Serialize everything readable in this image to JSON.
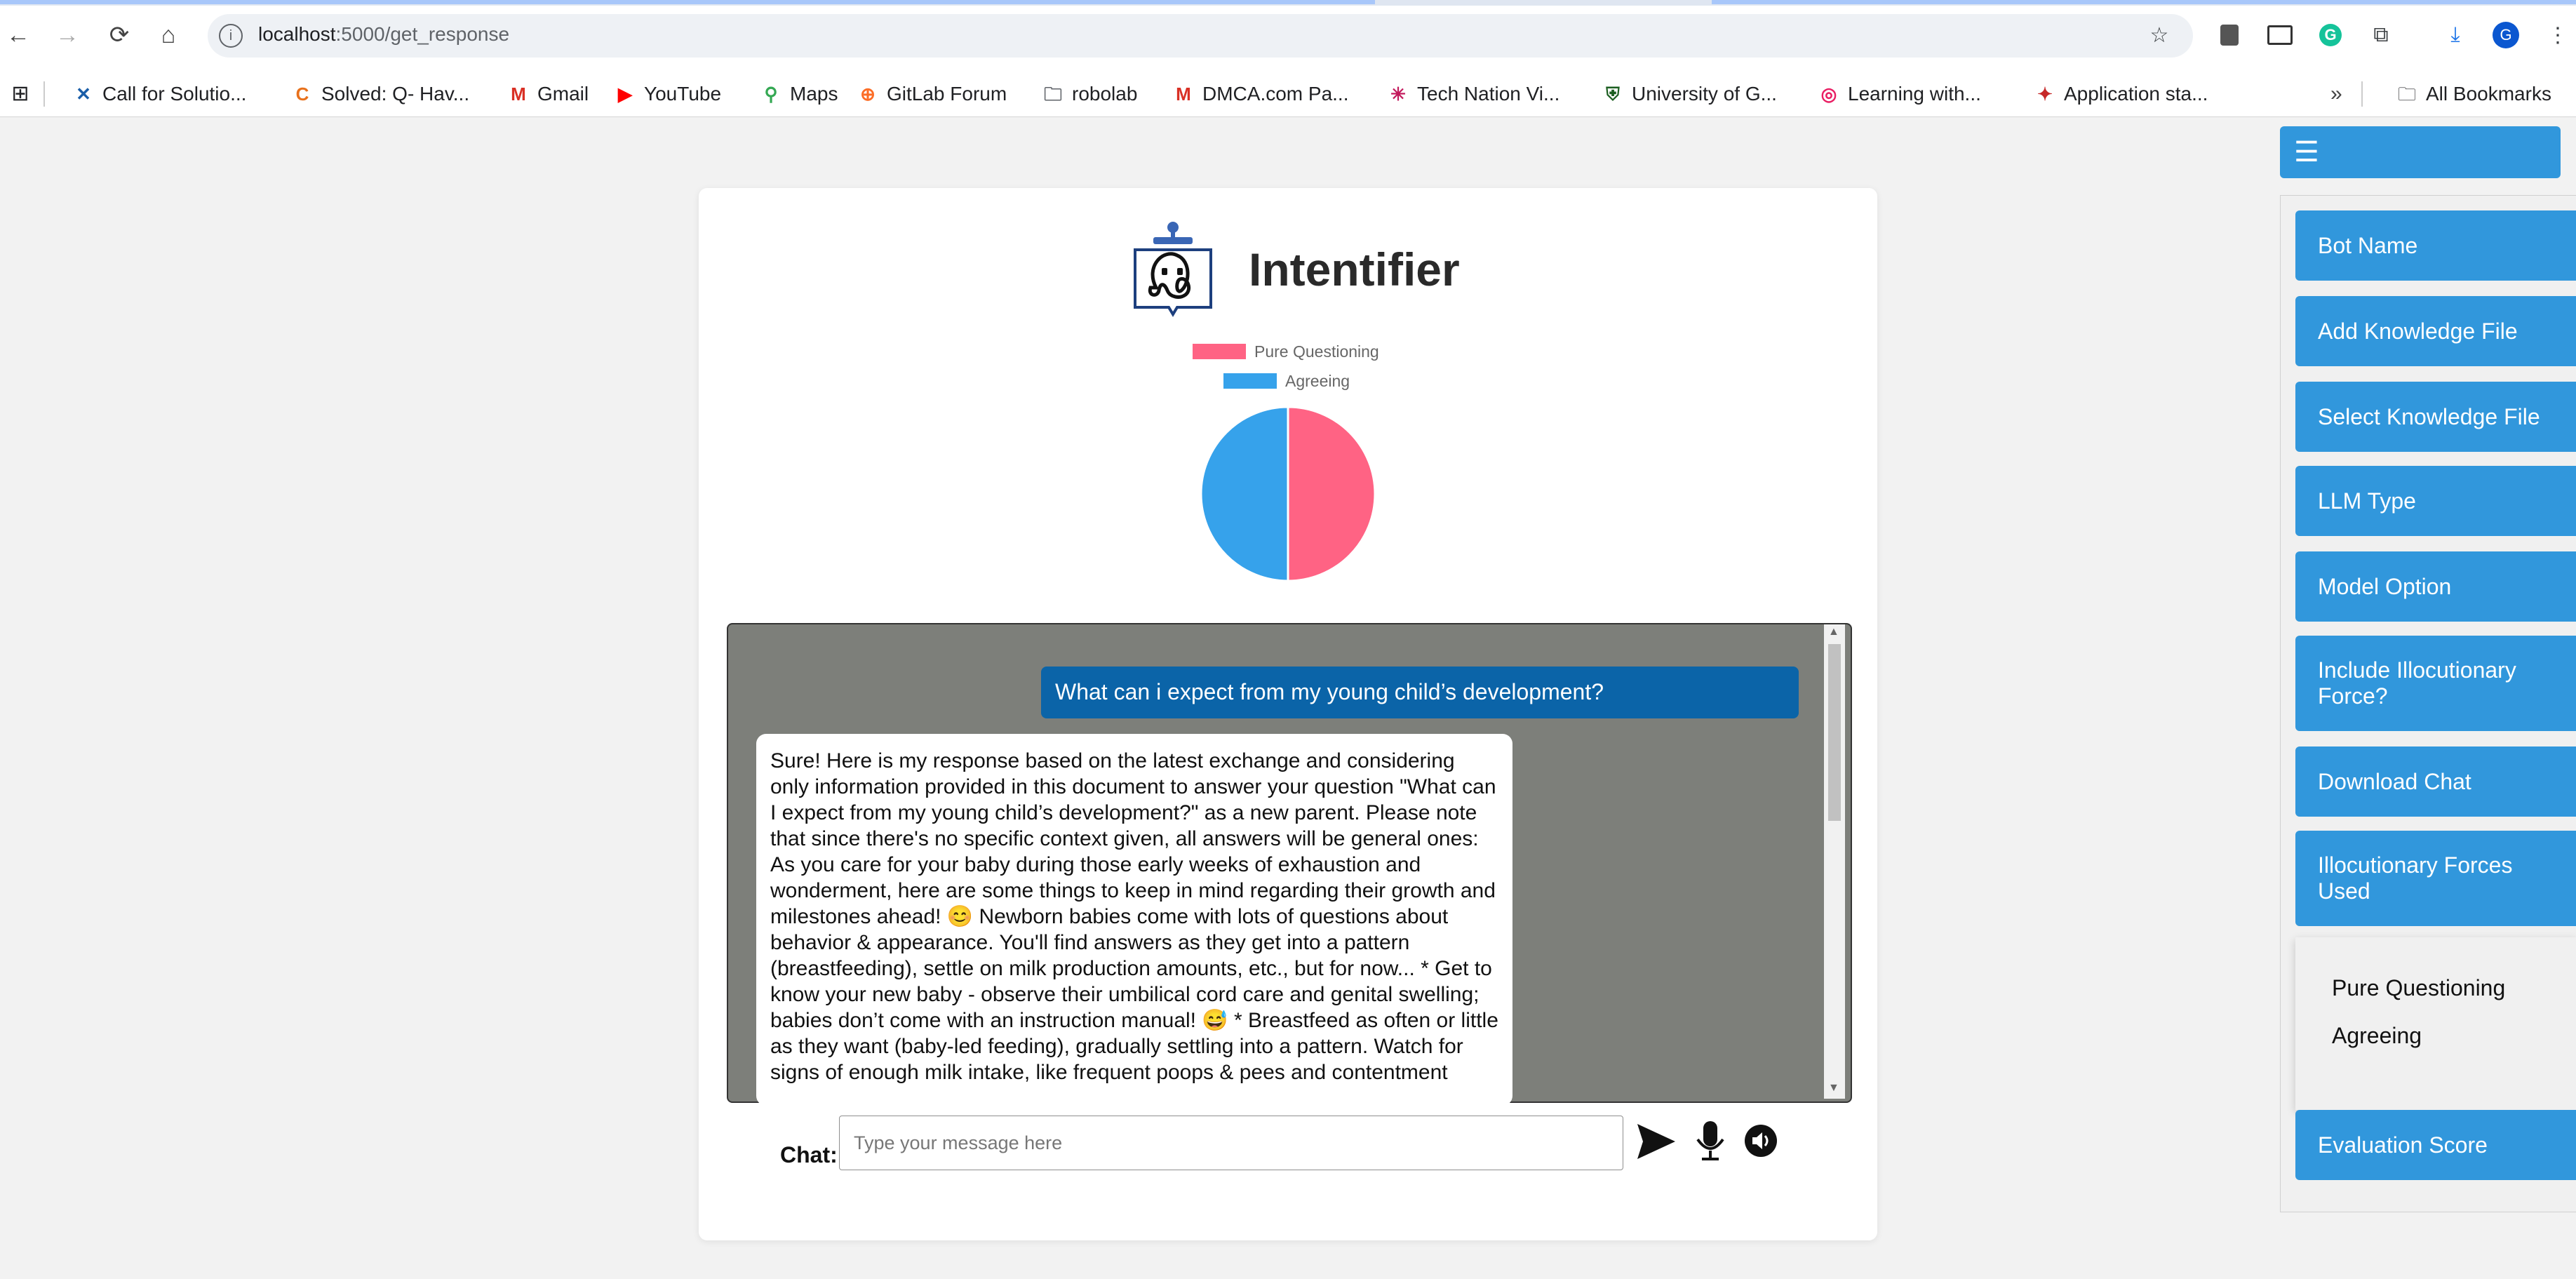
{
  "browser": {
    "url_host": "localhost",
    "url_path": ":5000/get_response",
    "bookmarks": [
      {
        "label": "Call for Solutio...",
        "icon": "x-icon",
        "color": "#1a5ea8"
      },
      {
        "label": "Solved: Q- Hav...",
        "icon": "c-icon",
        "color": "#e8711c"
      },
      {
        "label": "Gmail",
        "icon": "gmail-icon",
        "color": "#d93025"
      },
      {
        "label": "YouTube",
        "icon": "youtube-icon",
        "color": "#ff0000"
      },
      {
        "label": "Maps",
        "icon": "maps-icon",
        "color": "#34a853"
      },
      {
        "label": "GitLab Forum",
        "icon": "gitlab-icon",
        "color": "#fc6d26"
      },
      {
        "label": "robolab",
        "icon": "folder-icon",
        "color": "#5f6368"
      },
      {
        "label": "DMCA.com Pa...",
        "icon": "gmail-icon",
        "color": "#d93025"
      },
      {
        "label": "Tech Nation Vi...",
        "icon": "star-burst-icon",
        "color": "#c2185b"
      },
      {
        "label": "University of G...",
        "icon": "crest-icon",
        "color": "#1b5e20"
      },
      {
        "label": "Learning with...",
        "icon": "swirl-icon",
        "color": "#e91e63"
      },
      {
        "label": "Application sta...",
        "icon": "bird-icon",
        "color": "#c62828"
      }
    ],
    "all_bookmarks": "All Bookmarks",
    "profile_initial": "G"
  },
  "app": {
    "title": "Intentifier",
    "legend": [
      {
        "label": "Pure Questioning",
        "color": "#ff6384"
      },
      {
        "label": "Agreeing",
        "color": "#36a2eb"
      }
    ]
  },
  "chart_data": {
    "type": "pie",
    "categories": [
      "Pure Questioning",
      "Agreeing"
    ],
    "values": [
      1,
      1
    ],
    "colors": [
      "#ff6384",
      "#36a2eb"
    ],
    "legend_position": "top"
  },
  "chat": {
    "user_message": "What can i expect from my young child’s development?",
    "bot_message": "Sure! Here is my response based on the latest exchange and considering only information provided in this document to answer your question \"What can I expect from my young child’s development?\" as a new parent. Please note that since there's no specific context given, all answers will be general ones: As you care for your baby during those early weeks of exhaustion and wonderment, here are some things to keep in mind regarding their growth and milestones ahead! 😊 Newborn babies come with lots of questions about behavior & appearance. You'll find answers as they get into a pattern (breastfeeding), settle on milk production amounts, etc., but for now... * Get to know your new baby - observe their umbilical cord care and genital swelling; babies don’t come with an instruction manual! 😅 * Breastfeed as often or little as they want (baby-led feeding), gradually settling into a pattern. Watch for signs of enough milk intake, like frequent poops & pees and contentment",
    "label": "Chat:",
    "placeholder": "Type your message here"
  },
  "sidebar": {
    "toggle_icon": "☰",
    "buttons": [
      "Bot Name",
      "Add Knowledge File",
      "Select Knowledge File",
      "LLM Type",
      "Model Option",
      "Include Illocutionary Force?",
      "Download Chat",
      "Illocutionary Forces Used",
      "Evaluation Score"
    ],
    "forces": [
      "Pure Questioning",
      "Agreeing"
    ]
  }
}
